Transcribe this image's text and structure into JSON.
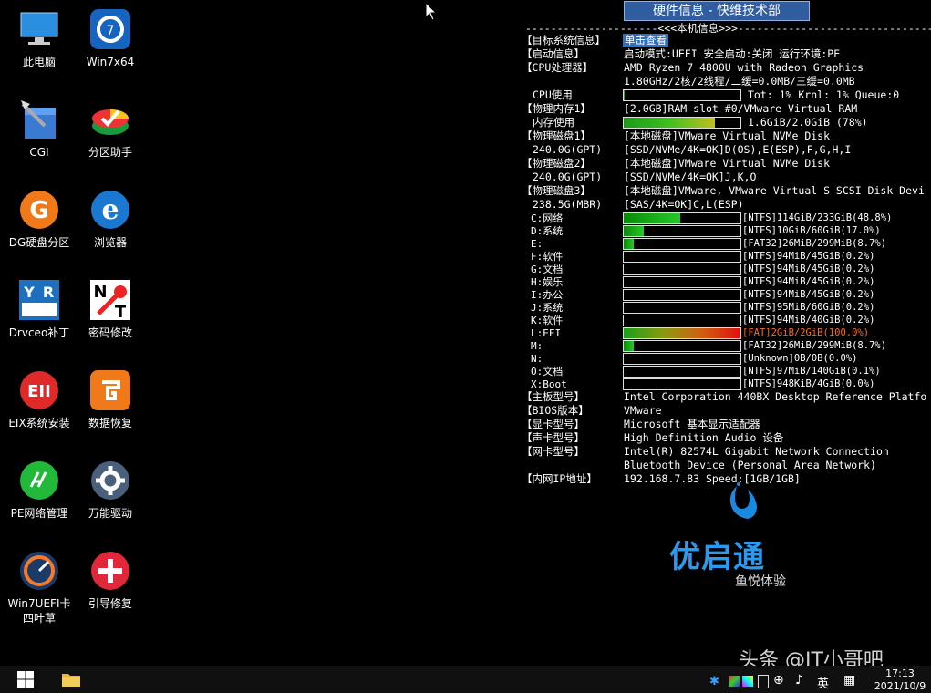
{
  "desktop_icons": [
    {
      "label": "此电脑",
      "icon": "computer-icon"
    },
    {
      "label": "Win7x64",
      "icon": "win7-icon"
    },
    {
      "label": "CGI",
      "icon": "cgi-icon"
    },
    {
      "label": "分区助手",
      "icon": "partition-assistant-icon"
    },
    {
      "label": "DG硬盘分区",
      "icon": "dg-icon"
    },
    {
      "label": "浏览器",
      "icon": "browser-icon"
    },
    {
      "label": "Drvceo补丁",
      "icon": "drvceo-icon"
    },
    {
      "label": "密码修改",
      "icon": "password-icon"
    },
    {
      "label": "EIX系统安装",
      "icon": "eix-icon"
    },
    {
      "label": "数据恢复",
      "icon": "data-recovery-icon"
    },
    {
      "label": "PE网络管理",
      "icon": "network-icon"
    },
    {
      "label": "万能驱动",
      "icon": "driver-icon"
    },
    {
      "label": "Win7UEFI卡四叶草",
      "icon": "clover-icon"
    },
    {
      "label": "引导修复",
      "icon": "boot-repair-icon"
    }
  ],
  "header": {
    "title": "硬件信息 - 快维技术部",
    "separator": "---------------------<<<本机信息>>>-------------------------------"
  },
  "info": {
    "target_label": "【目标系统信息】",
    "target_button": "单击查看",
    "boot_label": "【启动信息】",
    "boot_value": "启动模式:UEFI   安全启动:关闭   运行环境:PE",
    "cpu_label": "【CPU处理器】",
    "cpu_value": "AMD Ryzen 7 4800U with Radeon Graphics",
    "cpu_detail": "1.80GHz/2核/2线程/二缓=0.0MB/三缓=0.0MB",
    "cpu_use_label": "CPU使用",
    "cpu_use_value": "Tot: 1% Krnl: 1% Queue:0",
    "cpu_use_fraction": 0.01,
    "mem_label": "【物理内存1】",
    "mem_value": "[2.0GB]RAM slot #0/VMware Virtual RAM",
    "mem_use_label": "内存使用",
    "mem_use_value": "1.6GiB/2.0GiB (78%)",
    "mem_use_fraction": 0.78,
    "disk1_label": "【物理磁盘1】",
    "disk1_value": "[本地磁盘]VMware Virtual NVMe Disk",
    "disk1_size": "240.0G(GPT)",
    "disk1_detail": "[SSD/NVMe/4K=OK]D(OS),E(ESP),F,G,H,I",
    "disk2_label": "【物理磁盘2】",
    "disk2_value": "[本地磁盘]VMware Virtual NVMe Disk",
    "disk2_size": "240.0G(GPT)",
    "disk2_detail": "[SSD/NVMe/4K=OK]J,K,O",
    "disk3_label": "【物理磁盘3】",
    "disk3_value": "[本地磁盘]VMware, VMware Virtual S SCSI Disk Devi",
    "disk3_size": "238.5G(MBR)",
    "disk3_detail": "[SAS/4K=OK]C,L(ESP)",
    "board_label": "【主板型号】",
    "board_value": "Intel Corporation 440BX Desktop Reference Platfo",
    "bios_label": "【BIOS版本】",
    "bios_value": "VMware",
    "gpu_label": "【显卡型号】",
    "gpu_value": "Microsoft 基本显示适配器",
    "audio_label": "【声卡型号】",
    "audio_value": "High Definition Audio 设备",
    "nic_label": "【网卡型号】",
    "nic_value": "Intel(R) 82574L Gigabit Network Connection",
    "nic_value2": "Bluetooth Device (Personal Area Network)",
    "ip_label": "【内网IP地址】",
    "ip_value": "192.168.7.83  Speed:[1GB/1GB]"
  },
  "drives": [
    {
      "name": "C:网络",
      "info": "[NTFS]114GiB/233GiB(48.8%)",
      "fraction": 0.488
    },
    {
      "name": "D:系统",
      "info": "[NTFS]10GiB/60GiB(17.0%)",
      "fraction": 0.17
    },
    {
      "name": "E:",
      "info": "[FAT32]26MiB/299MiB(8.7%)",
      "fraction": 0.087
    },
    {
      "name": "F:软件",
      "info": "[NTFS]94MiB/45GiB(0.2%)",
      "fraction": 0.002
    },
    {
      "name": "G:文档",
      "info": "[NTFS]94MiB/45GiB(0.2%)",
      "fraction": 0.002
    },
    {
      "name": "H:娱乐",
      "info": "[NTFS]94MiB/45GiB(0.2%)",
      "fraction": 0.002
    },
    {
      "name": "I:办公",
      "info": "[NTFS]94MiB/45GiB(0.2%)",
      "fraction": 0.002
    },
    {
      "name": "J:系统",
      "info": "[NTFS]95MiB/60GiB(0.2%)",
      "fraction": 0.002
    },
    {
      "name": "K:软件",
      "info": "[NTFS]94MiB/40GiB(0.2%)",
      "fraction": 0.002
    },
    {
      "name": "L:EFI",
      "info": "[FAT]2GiB/2GiB(100.0%)",
      "fraction": 1.0,
      "warn": true
    },
    {
      "name": "M:",
      "info": "[FAT32]26MiB/299MiB(8.7%)",
      "fraction": 0.087
    },
    {
      "name": "N:",
      "info": "[Unknown]0B/0B(0.0%)",
      "fraction": 0.0
    },
    {
      "name": "O:文档",
      "info": "[NTFS]97MiB/140GiB(0.1%)",
      "fraction": 0.001
    },
    {
      "name": "X:Boot",
      "info": "[NTFS]948KiB/4GiB(0.0%)",
      "fraction": 0.0
    }
  ],
  "logo": {
    "brand": "优启通",
    "slogan": "鱼悦体验"
  },
  "watermark": "头条 @IT小哥吧",
  "taskbar": {
    "time": "17:13",
    "date": "2021/10/9",
    "ime": "英"
  },
  "colors": {
    "bar_green": "#28c828",
    "warn": "#ff6a1a",
    "header_btn": "#2f5da0",
    "brand_blue": "#1a8ae0"
  }
}
